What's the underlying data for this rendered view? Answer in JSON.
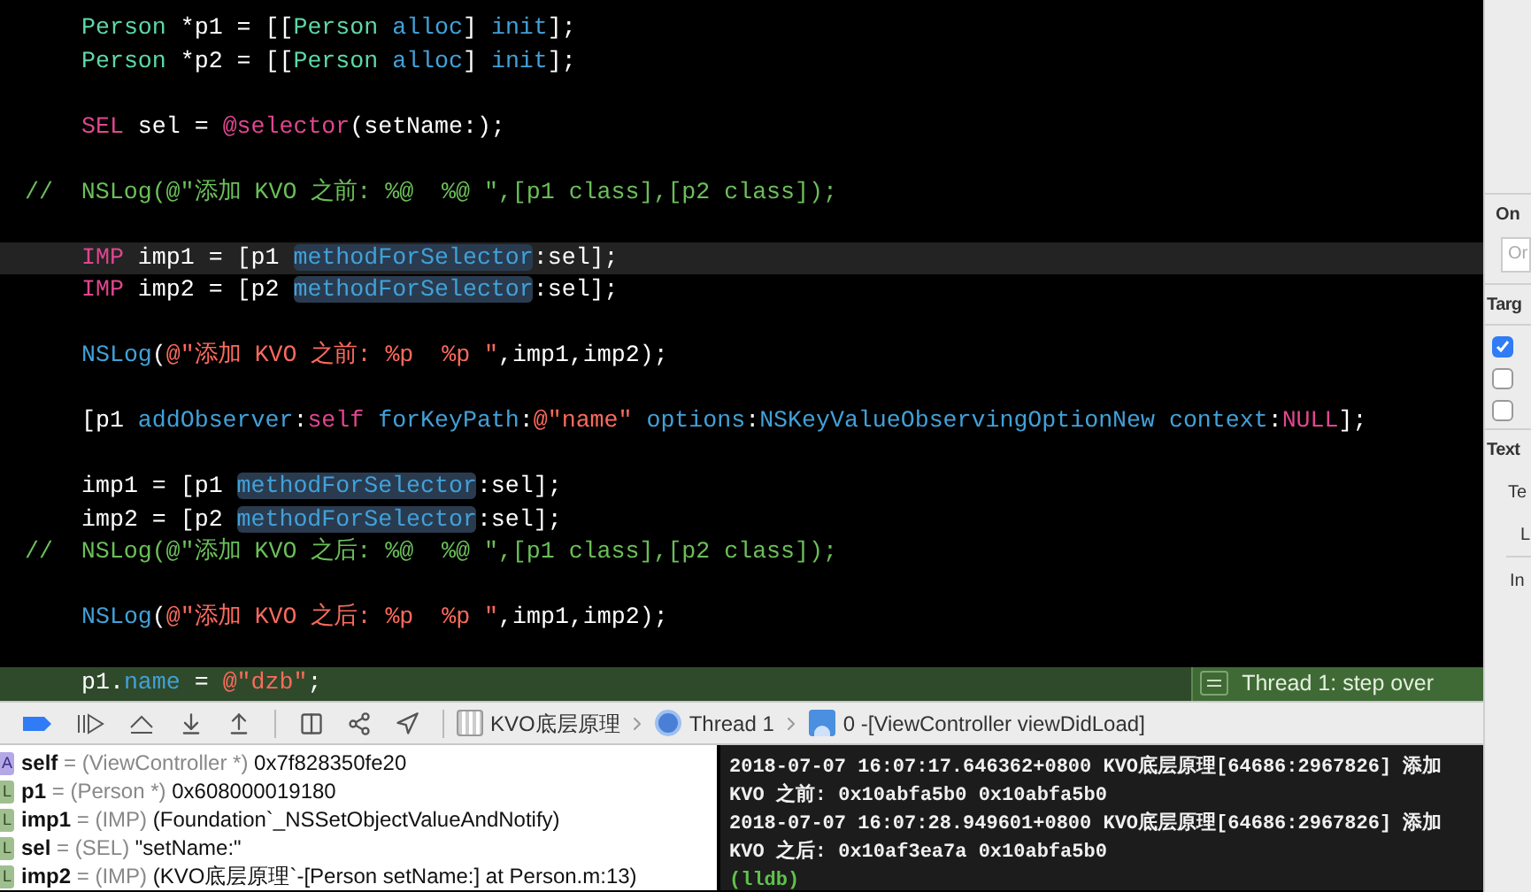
{
  "editor": {
    "lines": [
      {
        "indented": true,
        "cursor": false,
        "stepping": false,
        "tokens": [
          {
            "text": "Person",
            "kind": "type"
          },
          {
            "text": " *p1 = [["
          },
          {
            "text": "Person",
            "kind": "type"
          },
          {
            "text": " alloc",
            "kind": "method"
          },
          {
            "text": "] "
          },
          {
            "text": "init",
            "kind": "method"
          },
          {
            "text": "];"
          }
        ]
      },
      {
        "indented": true,
        "cursor": false,
        "stepping": false,
        "tokens": [
          {
            "text": "Person",
            "kind": "type"
          },
          {
            "text": " *p2 = [["
          },
          {
            "text": "Person",
            "kind": "type"
          },
          {
            "text": " alloc",
            "kind": "method"
          },
          {
            "text": "] "
          },
          {
            "text": "init",
            "kind": "method"
          },
          {
            "text": "];"
          }
        ]
      },
      {
        "cursor": false,
        "stepping": false
      },
      {
        "indented": true,
        "cursor": false,
        "stepping": false,
        "tokens": [
          {
            "text": "SEL",
            "kind": "keyword"
          },
          {
            "text": " sel = "
          },
          {
            "text": "@selector",
            "kind": "keyword"
          },
          {
            "text": "(setName:);"
          }
        ]
      },
      {
        "cursor": false,
        "stepping": false
      },
      {
        "indented": false,
        "cursor": false,
        "stepping": false,
        "tokens": [
          {
            "text": "//  NSLog(@\"添加 KVO 之前: %@  %@ \",[p1 class],[p2 class]);",
            "kind": "comment"
          }
        ]
      },
      {
        "cursor": false,
        "stepping": false
      },
      {
        "indented": true,
        "cursor": true,
        "stepping": false,
        "tokens": [
          {
            "text": "IMP",
            "kind": "keyword"
          },
          {
            "text": " imp1 = [p1 "
          },
          {
            "text": "methodForSelector",
            "kind": "match"
          },
          {
            "text": ":sel];"
          }
        ]
      },
      {
        "indented": true,
        "cursor": false,
        "stepping": false,
        "tokens": [
          {
            "text": "IMP",
            "kind": "keyword"
          },
          {
            "text": " imp2 = [p2 "
          },
          {
            "text": "methodForSelector",
            "kind": "match"
          },
          {
            "text": ":sel];"
          }
        ]
      },
      {
        "cursor": false,
        "stepping": false
      },
      {
        "indented": true,
        "cursor": false,
        "stepping": false,
        "tokens": [
          {
            "text": "NSLog",
            "kind": "method"
          },
          {
            "text": "("
          },
          {
            "text": "@\"添加 KVO 之前: %p  %p \"",
            "kind": "string"
          },
          {
            "text": ",imp1,imp2);"
          }
        ]
      },
      {
        "cursor": false,
        "stepping": false
      },
      {
        "indented": true,
        "cursor": false,
        "stepping": false,
        "tokens": [
          {
            "text": "[p1 "
          },
          {
            "text": "addObserver",
            "kind": "method"
          },
          {
            "text": ":"
          },
          {
            "text": "self",
            "kind": "keyword"
          },
          {
            "text": " forKeyPath",
            "kind": "method"
          },
          {
            "text": ":"
          },
          {
            "text": "@\"name\"",
            "kind": "string"
          },
          {
            "text": " options",
            "kind": "method"
          },
          {
            "text": ":"
          },
          {
            "text": "NSKeyValueObservingOptionNew context",
            "kind": "method"
          },
          {
            "text": ":"
          },
          {
            "text": "NULL",
            "kind": "keyword"
          },
          {
            "text": "];"
          }
        ]
      },
      {
        "cursor": false,
        "stepping": false
      },
      {
        "indented": true,
        "cursor": false,
        "stepping": false,
        "tokens": [
          {
            "text": "imp1 = [p1 "
          },
          {
            "text": "methodForSelector",
            "kind": "match"
          },
          {
            "text": ":sel];"
          }
        ]
      },
      {
        "indented": true,
        "cursor": false,
        "stepping": false,
        "tokens": [
          {
            "text": "imp2 = [p2 "
          },
          {
            "text": "methodForSelector",
            "kind": "match"
          },
          {
            "text": ":sel];"
          }
        ]
      },
      {
        "indented": false,
        "cursor": false,
        "stepping": false,
        "tokens": [
          {
            "text": "//  NSLog(@\"添加 KVO 之后: %@  %@ \",[p1 class],[p2 class]);",
            "kind": "comment"
          }
        ]
      },
      {
        "cursor": false,
        "stepping": false
      },
      {
        "indented": true,
        "cursor": false,
        "stepping": false,
        "tokens": [
          {
            "text": "NSLog",
            "kind": "method"
          },
          {
            "text": "("
          },
          {
            "text": "@\"添加 KVO 之后: %p  %p \"",
            "kind": "string"
          },
          {
            "text": ",imp1,imp2);"
          }
        ]
      },
      {
        "cursor": false,
        "stepping": false
      },
      {
        "indented": true,
        "cursor": false,
        "stepping": true,
        "tokens": [
          {
            "text": "p1."
          },
          {
            "text": "name",
            "kind": "method"
          },
          {
            "text": " = "
          },
          {
            "text": "@\"dzb\"",
            "kind": "string"
          },
          {
            "text": ";"
          }
        ]
      }
    ],
    "step_badge": "Thread 1: step over"
  },
  "inspector": {
    "section_1": "On",
    "field_placeholder": "Or",
    "section_2": "Targ",
    "targets": [
      {
        "checked": true
      },
      {
        "checked": false
      },
      {
        "checked": false
      }
    ],
    "section_3": "Text",
    "label_1": "Te",
    "label_2": "L",
    "label_3": "In"
  },
  "debug_bar": {
    "breadcrumbs": [
      {
        "kind": "project",
        "text": "KVO底层原理"
      },
      {
        "kind": "thread",
        "text": "Thread 1"
      },
      {
        "kind": "frame",
        "text": "0 -[ViewController viewDidLoad]"
      }
    ]
  },
  "variables": [
    {
      "kind": "argument",
      "badge": "A",
      "name": "self",
      "separator": "=",
      "type": "(ViewController *)",
      "value": "0x7f828350fe20"
    },
    {
      "kind": "local",
      "badge": "L",
      "name": "p1",
      "separator": "=",
      "type": "(Person *)",
      "value": "0x608000019180"
    },
    {
      "kind": "local",
      "badge": "L",
      "name": "imp1",
      "separator": "=",
      "type": "(IMP)",
      "value": "(Foundation`_NSSetObjectValueAndNotify)"
    },
    {
      "kind": "local",
      "badge": "L",
      "name": "sel",
      "separator": "=",
      "type": "(SEL)",
      "value": "\"setName:\""
    },
    {
      "kind": "local",
      "badge": "L",
      "name": "imp2",
      "separator": "=",
      "type": "(IMP)",
      "value": "(KVO底层原理`-[Person setName:] at Person.m:13)"
    }
  ],
  "console": {
    "lines": [
      {
        "kind": "output",
        "text": "2018-07-07 16:07:17.646362+0800 KVO底层原理[64686:2967826] 添加"
      },
      {
        "kind": "output",
        "text": "KVO 之前: 0x10abfa5b0  0x10abfa5b0"
      },
      {
        "kind": "output",
        "text": "2018-07-07 16:07:28.949601+0800 KVO底层原理[64686:2967826] 添加"
      },
      {
        "kind": "output",
        "text": "KVO 之后: 0x10af3ea7a  0x10abfa5b0"
      },
      {
        "kind": "prompt",
        "text": "(lldb)"
      }
    ]
  }
}
